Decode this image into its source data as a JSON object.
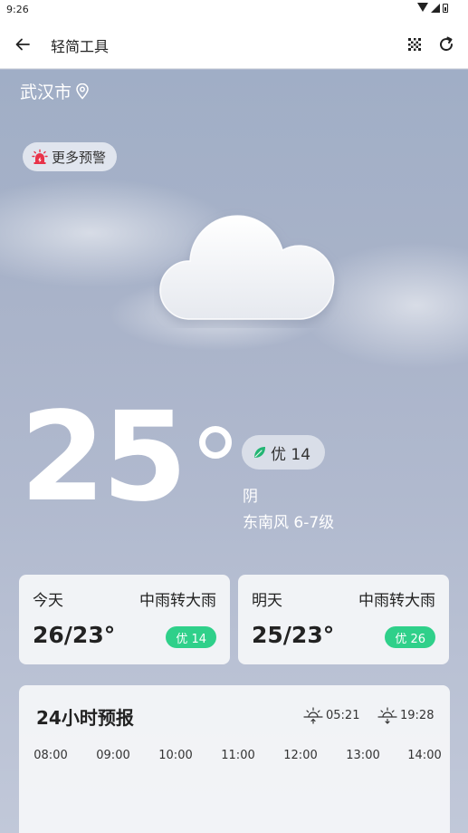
{
  "status_bar": {
    "time": "9:26"
  },
  "app_bar": {
    "title": "轻简工具"
  },
  "location": {
    "city": "武汉市"
  },
  "warning": {
    "label": "更多预警"
  },
  "current": {
    "temperature": "25",
    "aqi_label": "优 14",
    "condition": "阴",
    "wind": "东南风 6-7级"
  },
  "days": [
    {
      "label": "今天",
      "condition": "中雨转大雨",
      "temp": "26/23°",
      "aqi": "优 14"
    },
    {
      "label": "明天",
      "condition": "中雨转大雨",
      "temp": "25/23°",
      "aqi": "优 26"
    }
  ],
  "forecast": {
    "title": "24小时预报",
    "sunrise": "05:21",
    "sunset": "19:28",
    "hours": [
      "08:00",
      "09:00",
      "10:00",
      "11:00",
      "12:00",
      "13:00",
      "14:00"
    ]
  },
  "colors": {
    "aqi_green": "#2fd08a",
    "warning_red": "#e8334a",
    "leaf_green": "#22b573"
  }
}
